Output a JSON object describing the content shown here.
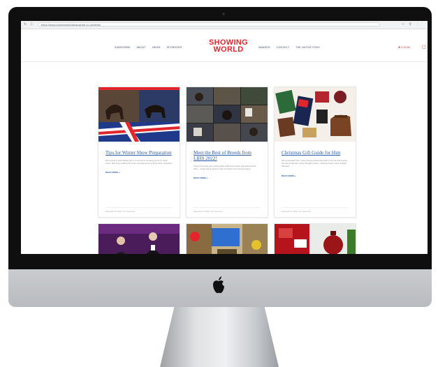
{
  "browser": {
    "url": "https://www.showingworldmagazine.co.uk/news/"
  },
  "nav": {
    "left": [
      "SUBSCRIBE",
      "ABOUT",
      "NEWS",
      "SPONSORS"
    ],
    "right": [
      "AWARDS",
      "CONTACT",
      "THE NATIVE PONY"
    ],
    "login_label": "LOGIN"
  },
  "brand": {
    "line1": "SHOWING",
    "line2": "WORLD",
    "color": "#e3262d"
  },
  "cards": [
    {
      "title": "Tips for Winter Show Preparation",
      "excerpt": "We're joined by Katie Meads who is on the tips for preparing ponies for winter shows. With those qualified for London International Horse Show 2022, preparation",
      "read_more": "READ MORE »",
      "meta": "December 15, 2022 • No Comments"
    },
    {
      "title": "Meet the Best of Breeds from LIHS 2022!",
      "excerpt": "These 13 beauties were declared Best of Breed at London International Horse Show... Clydes had remained to their Coronation best of breeds and as...",
      "read_more": "READ MORE »",
      "meta": "December 13, 2022 • No Comments"
    },
    {
      "title": "Christmas Gift Guide for Him",
      "excerpt": "Still unorganised? Don't panic! Showing World Gifts Sold for the man this showing. We have a wide little unique thoughtful options - Showing World is about a Saudi Deliveries",
      "read_more": "READ MORE »",
      "meta": "December 12, 2022 • No Comments"
    }
  ],
  "colors": {
    "accent": "#e3262d",
    "link": "#2f5ea8",
    "bezel": "#0f0f10"
  }
}
